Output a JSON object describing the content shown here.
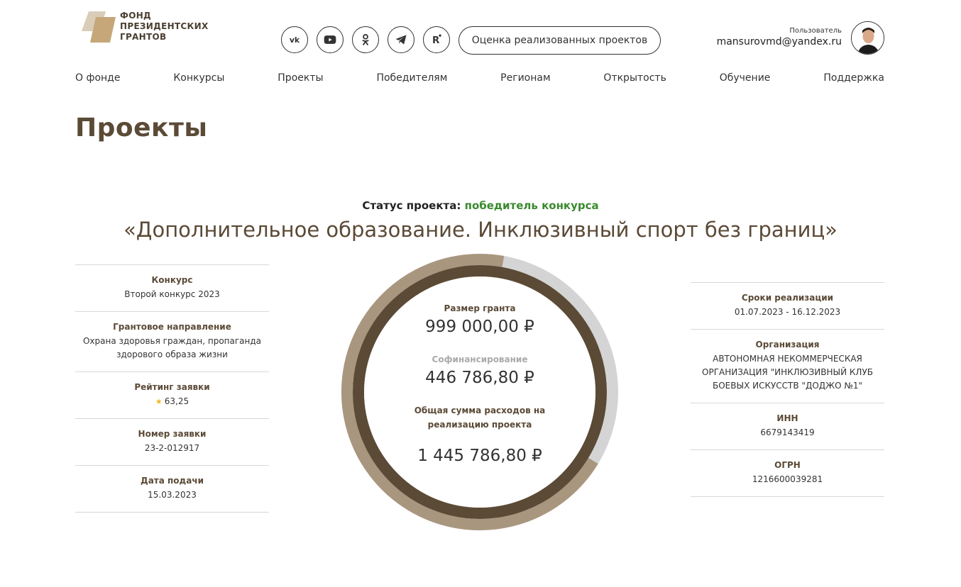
{
  "logo": {
    "line1": "ФОНД",
    "line2": "ПРЕЗИДЕНТСКИХ",
    "line3": "ГРАНТОВ"
  },
  "socials": [
    "vk-icon",
    "youtube-icon",
    "odnoklassniki-icon",
    "telegram-icon",
    "rutube-icon"
  ],
  "eval_button": "Оценка реализованных проектов",
  "user": {
    "label": "Пользователь",
    "email": "mansurovmd@yandex.ru"
  },
  "nav": [
    "О фонде",
    "Конкурсы",
    "Проекты",
    "Победителям",
    "Регионам",
    "Открытость",
    "Обучение",
    "Поддержка"
  ],
  "page_title": "Проекты",
  "status": {
    "label": "Статус проекта:",
    "value": "победитель конкурса"
  },
  "project_title": "«Дополнительное образование. Инклюзивный спорт без границ»",
  "left_info": [
    {
      "key": "Конкурс",
      "value": "Второй конкурс 2023"
    },
    {
      "key": "Грантовое направление",
      "value": "Охрана здоровья граждан, пропаганда здорового образа жизни"
    },
    {
      "key": "Рейтинг заявки",
      "value": "63,25"
    },
    {
      "key": "Номер заявки",
      "value": "23-2-012917"
    },
    {
      "key": "Дата подачи",
      "value": "15.03.2023"
    }
  ],
  "right_info": [
    {
      "key": "Сроки реализации",
      "value": "01.07.2023 - 16.12.2023"
    },
    {
      "key": "Организация",
      "value": "АВТОНОМНАЯ НЕКОММЕРЧЕСКАЯ ОРГАНИЗАЦИЯ \"ИНКЛЮЗИВНЫЙ КЛУБ БОЕВЫХ ИСКУССТВ \"ДОДЖО №1\""
    },
    {
      "key": "ИНН",
      "value": "6679143419"
    },
    {
      "key": "ОГРН",
      "value": "1216600039281"
    }
  ],
  "finance": {
    "grant_label": "Размер гранта",
    "grant_value": "999 000,00 ₽",
    "cofin_label": "Софинансирование",
    "cofin_value": "446 786,80 ₽",
    "total_label_1": "Общая сумма расходов на",
    "total_label_2": "реализацию проекта",
    "total_value": "1 445 786,80 ₽",
    "grant_share": 0.691
  },
  "colors": {
    "brown": "#5b4a36",
    "tan": "#a8967e",
    "gray_ring": "#d4d4d4",
    "green": "#3a8a2e"
  }
}
